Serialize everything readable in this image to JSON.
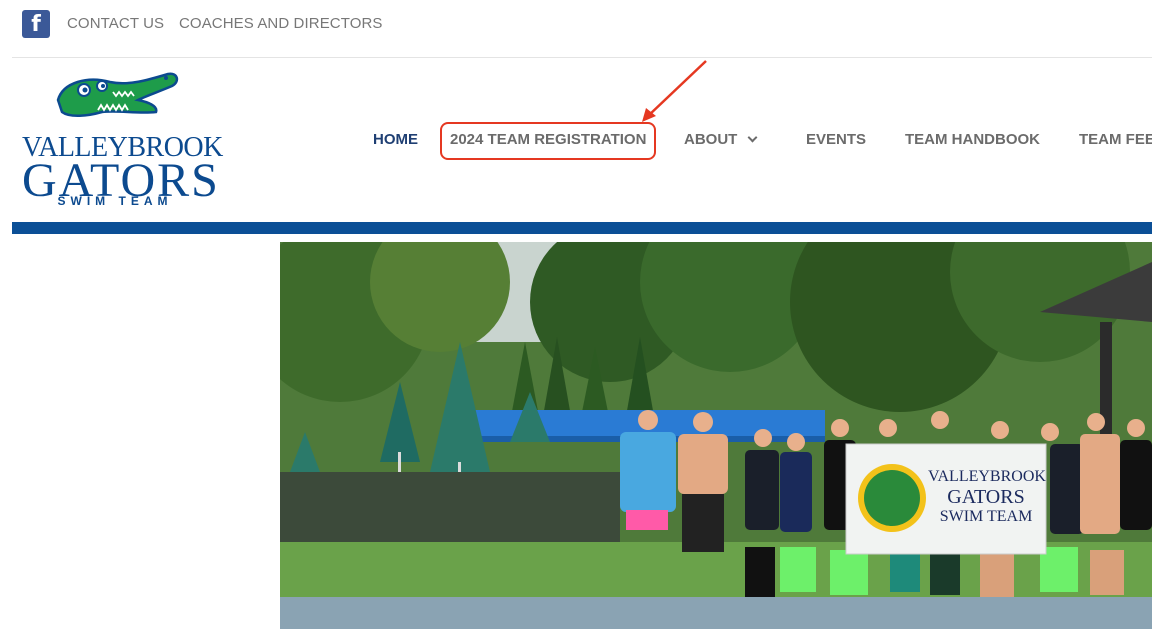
{
  "topbar": {
    "facebook_icon": "facebook-icon",
    "links": [
      "CONTACT US",
      "COACHES AND DIRECTORS"
    ]
  },
  "logo": {
    "line1": "VALLEYBROOK",
    "line2": "GATORS",
    "line3": "SWIM TEAM"
  },
  "nav": {
    "items": [
      "HOME",
      "2024 TEAM REGISTRATION",
      "ABOUT",
      "EVENTS",
      "TEAM HANDBOOK",
      "TEAM FEE"
    ],
    "active": "HOME",
    "highlighted": "2024 TEAM REGISTRATION"
  },
  "hero": {
    "banner": {
      "line1": "VALLEYBROOK",
      "line2": "GATORS",
      "line3": "SWIM TEAM"
    }
  },
  "colors": {
    "brand_blue": "#0b4f96",
    "gator_green": "#1e9c4a",
    "annotation_red": "#e53821",
    "nav_gray": "#6b6b6b"
  }
}
